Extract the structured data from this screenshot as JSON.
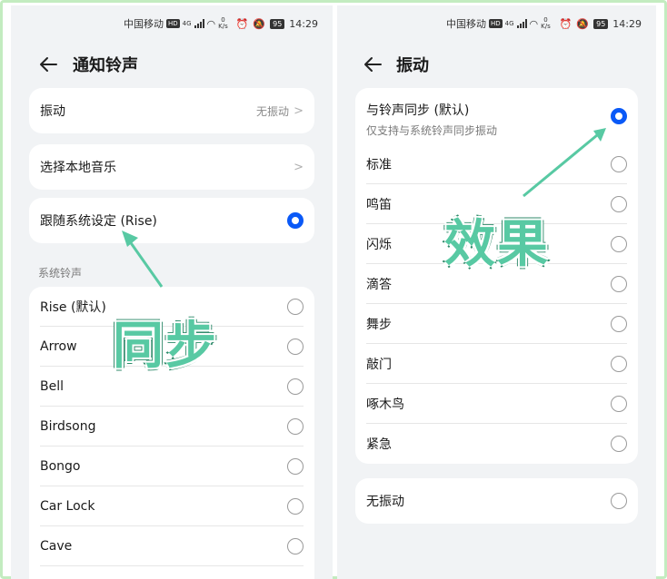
{
  "status_bar": {
    "carrier": "中国移动",
    "hd": "HD",
    "net_type": "4G",
    "speed_value": "0",
    "speed_unit": "K/s",
    "battery": "95",
    "time": "14:29"
  },
  "left_screen": {
    "title": "通知铃声",
    "vibration": {
      "label": "振动",
      "value": "无振动"
    },
    "local_music": {
      "label": "选择本地音乐"
    },
    "follow_system": {
      "label": "跟随系统设定 (Rise)",
      "selected": true
    },
    "section_label": "系统铃声",
    "ringtones": [
      "Rise (默认)",
      "Arrow",
      "Bell",
      "Birdsong",
      "Bongo",
      "Car Lock",
      "Cave"
    ],
    "annotation": "同步"
  },
  "right_screen": {
    "title": "振动",
    "options": [
      {
        "label": "与铃声同步 (默认)",
        "sub": "仅支持与系统铃声同步振动",
        "selected": true
      },
      {
        "label": "标准"
      },
      {
        "label": "鸣笛"
      },
      {
        "label": "闪烁"
      },
      {
        "label": "滴答"
      },
      {
        "label": "舞步"
      },
      {
        "label": "敲门"
      },
      {
        "label": "啄木鸟"
      },
      {
        "label": "紧急"
      }
    ],
    "no_vibration": {
      "label": "无振动"
    },
    "annotation": "效果"
  },
  "colors": {
    "accent": "#0a59f7",
    "annotation_green": "#58c9a3",
    "background": "#f1f3f5"
  }
}
